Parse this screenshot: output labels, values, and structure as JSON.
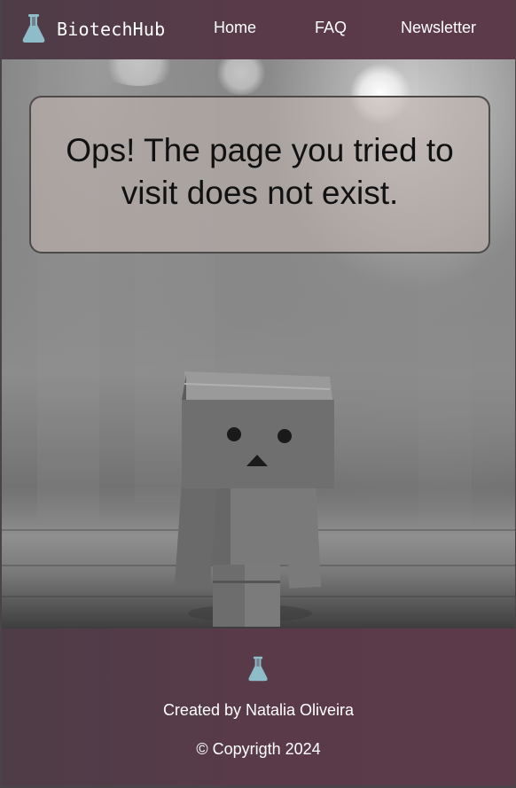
{
  "header": {
    "brand_name": "BiotechHub",
    "brand_icon": "flask-icon",
    "nav": {
      "home": "Home",
      "faq": "FAQ",
      "newsletter": "Newsletter"
    }
  },
  "main": {
    "error_message": "Ops! The page you tried to visit does not exist."
  },
  "footer": {
    "icon": "flask-icon",
    "credit": "Created by Natalia Oliveira",
    "copyright": "© Copyrigth 2024"
  },
  "colors": {
    "navbar_bg": "#5a3a49",
    "flask_accent": "#8fbcc9",
    "text_light": "#ffffff",
    "card_bg": "#beb2ac"
  }
}
